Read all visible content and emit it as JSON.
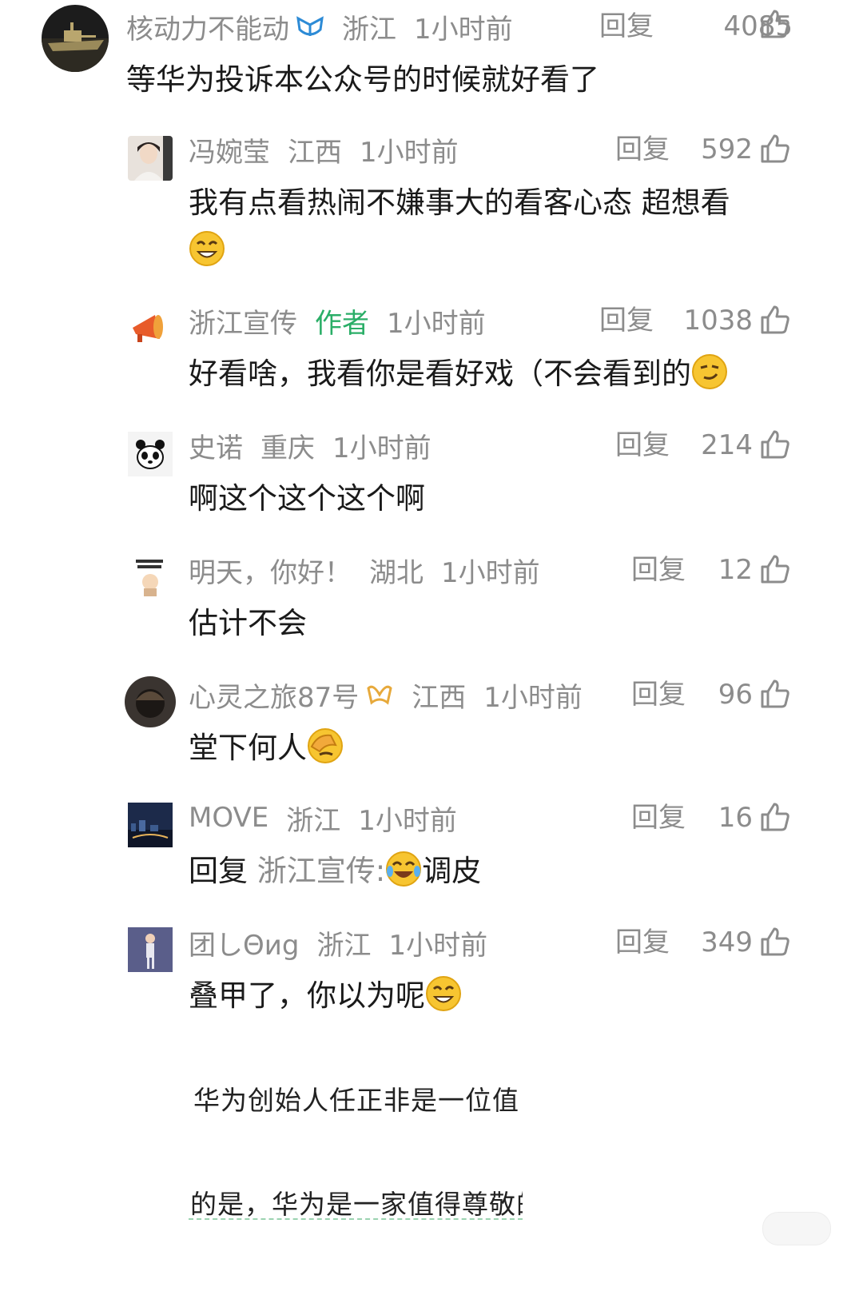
{
  "comments": [
    {
      "name": "核动力不能动",
      "location": "浙江",
      "time": "1小时前",
      "reply": "回复",
      "likes": "4085",
      "text": "等华为投诉本公众号的时候就好看了"
    },
    {
      "name": "冯婉莹",
      "location": "江西",
      "time": "1小时前",
      "reply": "回复",
      "likes": "592",
      "text": "我有点看热闹不嫌事大的看客心态 超想看"
    },
    {
      "name": "浙江宣传",
      "author_tag": "作者",
      "time": "1小时前",
      "reply": "回复",
      "likes": "1038",
      "text": "好看啥，我看你是看好戏（不会看到的"
    },
    {
      "name": "史诺",
      "location": "重庆",
      "time": "1小时前",
      "reply": "回复",
      "likes": "214",
      "text": "啊这个这个这个啊"
    },
    {
      "name": "明天，你好！",
      "location": "湖北",
      "time": "1小时前",
      "reply": "回复",
      "likes": "12",
      "text": "估计不会"
    },
    {
      "name": "心灵之旅87号",
      "location": "江西",
      "time": "1小时前",
      "reply": "回复",
      "likes": "96",
      "text": "堂下何人"
    },
    {
      "name": "MOVE",
      "location": "浙江",
      "time": "1小时前",
      "reply": "回复",
      "likes": "16",
      "reply_prefix": "回复",
      "reply_target": "浙江宣传:",
      "text": "调皮"
    },
    {
      "name": "团しΘиg",
      "location": "浙江",
      "time": "1小时前",
      "reply": "回复",
      "likes": "349",
      "text": "叠甲了，你以为呢"
    }
  ],
  "article": {
    "line1": "华为创始人任正非是一位值",
    "line2": "的是，华为是一家值得尊敬的"
  },
  "icons": {
    "like": "thumbs-up-icon",
    "badge_blue": "blue-verified-badge-icon",
    "badge_gold": "gold-verified-badge-icon"
  },
  "colors": {
    "meta_gray": "#8c8c8c",
    "author_green": "#2aae67",
    "text": "#1a1a1a"
  }
}
